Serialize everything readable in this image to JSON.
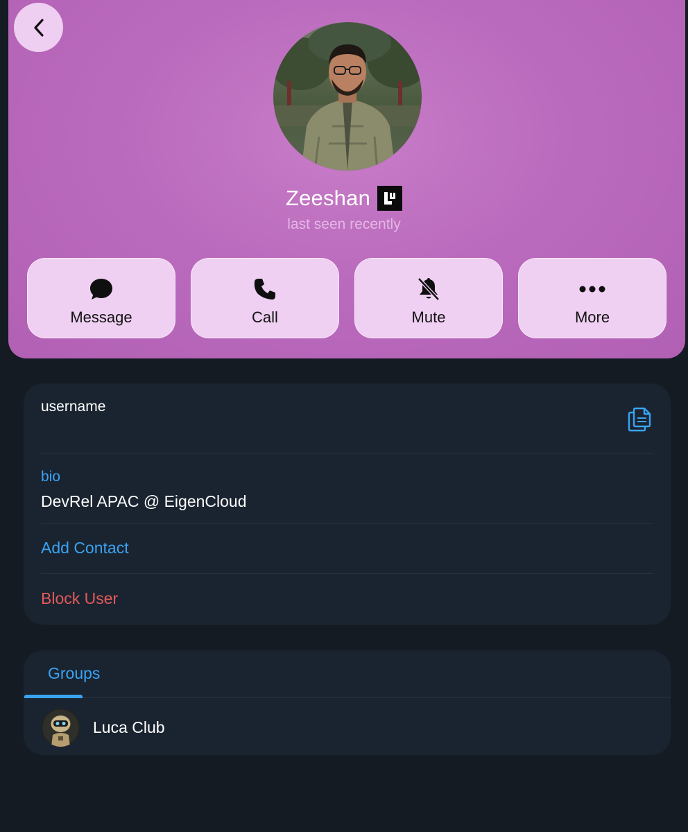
{
  "header": {
    "back_icon": "chevron-left-icon",
    "profile": {
      "name": "Zeeshan",
      "status": "last seen recently",
      "badge_icon": "brand-badge-icon"
    },
    "actions": [
      {
        "label": "Message",
        "icon": "chat-bubble-icon"
      },
      {
        "label": "Call",
        "icon": "phone-icon"
      },
      {
        "label": "Mute",
        "icon": "bell-slash-icon"
      },
      {
        "label": "More",
        "icon": "ellipsis-icon"
      }
    ],
    "colors": {
      "header_bg": "#bb6bbd",
      "button_bg": "#efcff2"
    }
  },
  "info": {
    "username_label": "username",
    "copy_icon": "copy-icon",
    "bio_label": "bio",
    "bio_value": "DevRel APAC @ EigenCloud",
    "add_contact": "Add Contact",
    "block_user": "Block User"
  },
  "groups": {
    "tab_label": "Groups",
    "items": [
      {
        "name": "Luca Club",
        "avatar_icon": "robot-avatar-icon"
      }
    ]
  },
  "colors": {
    "accent": "#3aa3f2",
    "danger": "#e5595b",
    "card_bg": "#1a2430",
    "page_bg": "#141b22"
  }
}
